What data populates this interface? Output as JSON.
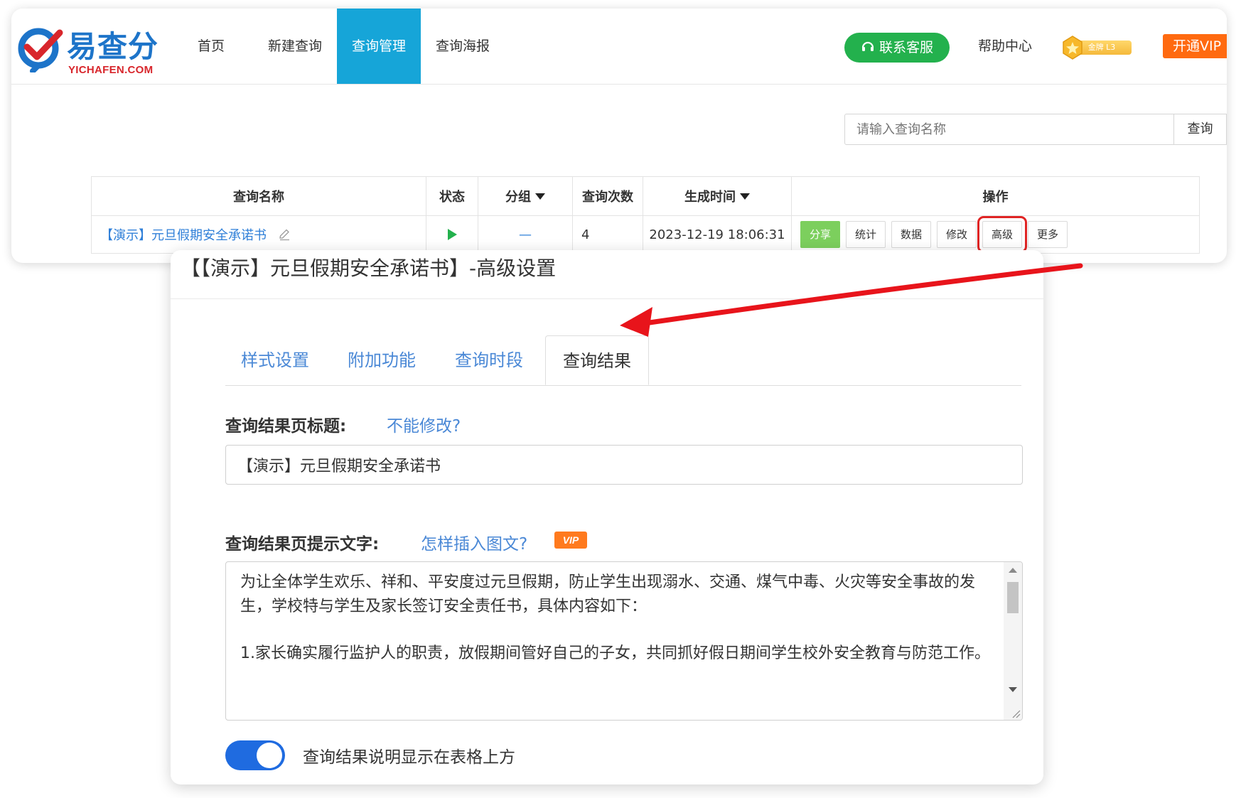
{
  "brand": {
    "logo_text": "易查分",
    "logo_sub": "YICHAFEN.COM",
    "colors": {
      "blue": "#1d74c9",
      "red": "#d8262c"
    }
  },
  "nav": {
    "items": [
      {
        "label": "首页"
      },
      {
        "label": "新建查询"
      },
      {
        "label": "查询管理",
        "active": true
      },
      {
        "label": "查询海报"
      }
    ],
    "service_button": "联系客服",
    "help": "帮助中心",
    "badge": "金牌 L3",
    "vip_button": "开通VIP",
    "active_color": "#16a5d8"
  },
  "search": {
    "placeholder": "请输入查询名称",
    "button": "查询"
  },
  "table": {
    "headers": {
      "name": "查询名称",
      "status": "状态",
      "group": "分组",
      "count": "查询次数",
      "time": "生成时间",
      "ops": "操作"
    },
    "rows": [
      {
        "name": "【演示】元旦假期安全承诺书",
        "status_icon": "play-icon",
        "group": "—",
        "count": "4",
        "time": "2023-12-19 18:06:31",
        "ops": {
          "share": "分享",
          "stats": "统计",
          "data": "数据",
          "edit": "修改",
          "advanced": "高级",
          "more": "更多"
        }
      }
    ]
  },
  "modal": {
    "title": "【【演示】元旦假期安全承诺书】-高级设置",
    "tabs": [
      {
        "label": "样式设置"
      },
      {
        "label": "附加功能"
      },
      {
        "label": "查询时段"
      },
      {
        "label": "查询结果",
        "active": true
      }
    ],
    "result_title": {
      "label": "查询结果页标题:",
      "help": "不能修改?",
      "value": "【演示】元旦假期安全承诺书"
    },
    "result_tip": {
      "label": "查询结果页提示文字:",
      "help": "怎样插入图文?",
      "vip": "VIP",
      "paragraphs": [
        "为让全体学生欢乐、祥和、平安度过元旦假期，防止学生出现溺水、交通、煤气中毒、火灾等安全事故的发生，学校特与学生及家长签订安全责任书，具体内容如下：",
        "1.家长确实履行监护人的职责，放假期间管好自己的子女，共同抓好假日期间学生校外安全教育与防范工作。"
      ]
    },
    "toggle": {
      "on": true,
      "label": "查询结果说明显示在表格上方"
    }
  }
}
